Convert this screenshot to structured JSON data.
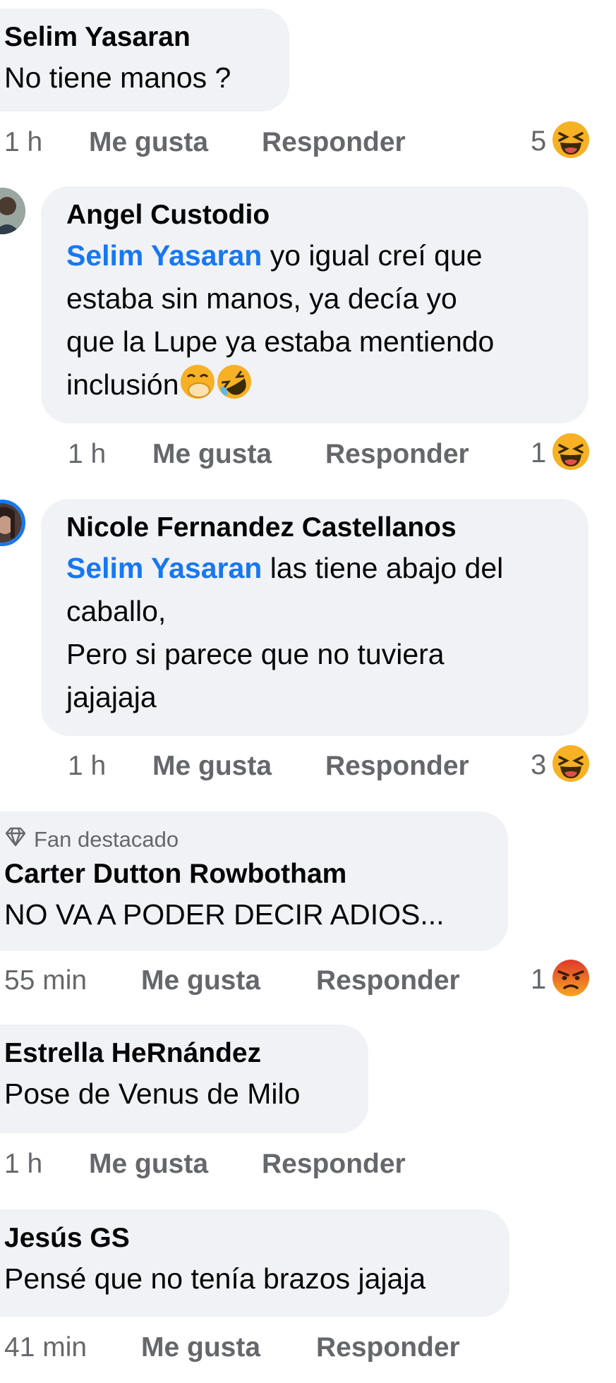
{
  "comments": [
    {
      "author": "Selim Yasaran",
      "text": "No tiene manos ?",
      "time": "1 h",
      "like": "Me gusta",
      "reply": "Responder",
      "reaction_count": "5",
      "reaction_icon": "laughing-squint-emoji-icon"
    },
    {
      "author": "Angel Custodio",
      "mention": "Selim Yasaran",
      "text_line1": " yo igual creí que",
      "text_line2": "estaba sin manos, ya decía yo",
      "text_line3": "que la Lupe ya estaba mentiendo",
      "text_line4": "inclusión",
      "text_emojis": [
        "hand-over-mouth-emoji-icon",
        "rolling-on-floor-laughing-emoji-icon"
      ],
      "time": "1 h",
      "like": "Me gusta",
      "reply": "Responder",
      "reaction_count": "1",
      "reaction_icon": "laughing-squint-emoji-icon"
    },
    {
      "author": "Nicole Fernandez Castellanos",
      "mention": "Selim Yasaran",
      "text_line1": " las tiene abajo del",
      "text_line2": "caballo,",
      "text_line3": "Pero si parece que no tuviera",
      "text_line4": "jajajaja",
      "time": "1 h",
      "like": "Me gusta",
      "reply": "Responder",
      "reaction_count": "3",
      "reaction_icon": "laughing-squint-emoji-icon"
    },
    {
      "badge": "Fan destacado",
      "author": "Carter Dutton Rowbotham",
      "text": "NO VA A PODER DECIR ADIOS...",
      "time": "55 min",
      "like": "Me gusta",
      "reply": "Responder",
      "reaction_count": "1",
      "reaction_icon": "angry-emoji-icon"
    },
    {
      "author": "Estrella HeRnández",
      "text": "Pose de Venus de Milo",
      "time": "1 h",
      "like": "Me gusta",
      "reply": "Responder"
    },
    {
      "author": "Jesús GS",
      "text": "Pensé que no tenía brazos jajaja",
      "time": "41 min",
      "like": "Me gusta",
      "reply": "Responder"
    }
  ],
  "colors": {
    "bubble": "#f0f2f5",
    "mention": "#1877f2",
    "meta": "#65676b",
    "haha": "#f7b125",
    "angry": "#e9710f"
  }
}
